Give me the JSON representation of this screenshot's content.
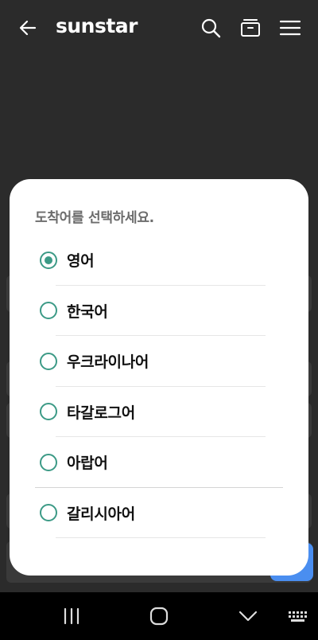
{
  "app": {
    "title": "sunstar"
  },
  "toolbar": {
    "back_icon": "arrow-left-icon",
    "search_icon": "search-icon",
    "archive_icon": "archive-icon",
    "menu_icon": "hamburger-menu-icon"
  },
  "dialog": {
    "title": "도착어를 선택하세요.",
    "options": [
      {
        "label": "영어",
        "selected": true
      },
      {
        "label": "한국어",
        "selected": false
      },
      {
        "label": "우크라이나어",
        "selected": false
      },
      {
        "label": "타갈로그어",
        "selected": false
      },
      {
        "label": "아랍어",
        "selected": false
      },
      {
        "label": "갈리시아어",
        "selected": false
      }
    ]
  },
  "navbar": {
    "recents_icon": "recent-apps-icon",
    "home_icon": "home-icon",
    "back_icon": "chevron-down-icon",
    "keyboard_icon": "keyboard-icon"
  },
  "colors": {
    "accent": "#3c9a86",
    "background": "#2b2b2b",
    "dialog": "#ffffff"
  }
}
